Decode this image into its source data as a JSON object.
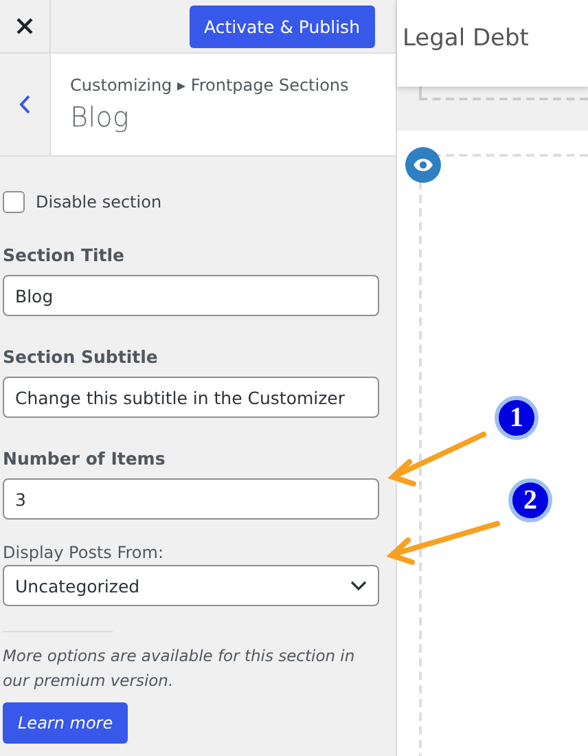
{
  "header": {
    "publish_button": "Activate & Publish"
  },
  "section_header": {
    "breadcrumb": "Customizing ▸ Frontpage Sections",
    "title": "Blog"
  },
  "controls": [
    {
      "kind": "checkbox",
      "label": "Disable section",
      "checked": false
    },
    {
      "kind": "text",
      "label": "Section Title",
      "value": "Blog"
    },
    {
      "kind": "text",
      "label": "Section Subtitle",
      "value": "Change this subtitle in the Customizer"
    },
    {
      "kind": "text",
      "label": "Number of Items",
      "value": "3"
    },
    {
      "kind": "select",
      "label": "Display Posts From:",
      "value": "Uncategorized"
    }
  ],
  "upsell": {
    "text": "More options are available for this section in our premium version.",
    "button": "Learn more"
  },
  "preview": {
    "site_title": "Legal Debt"
  },
  "annotations": [
    {
      "number": "1"
    },
    {
      "number": "2"
    }
  ]
}
